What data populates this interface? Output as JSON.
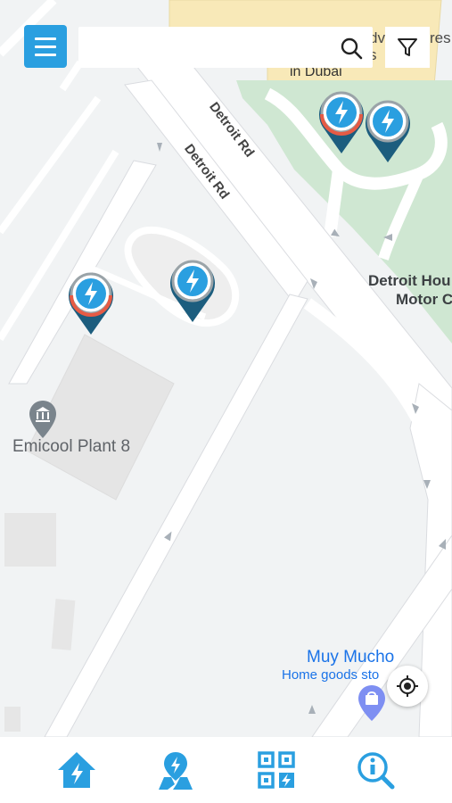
{
  "map": {
    "roads": [
      {
        "label": "Detroit Rd"
      },
      {
        "label": "Detroit Rd"
      }
    ],
    "pois": {
      "top_partial_line1": "dv",
      "top_partial_line2": "s",
      "top_partial_res": "res",
      "top_partial_dubai": "in Dubai",
      "detroit_house_line1": "Detroit Hou",
      "detroit_house_line2": "Motor C",
      "emicool": "Emicool Plant 8",
      "muy_mucho": "Muy Mucho",
      "muy_mucho_sub": "Home goods sto"
    },
    "markers": [
      {
        "id": "marker-1",
        "status": "partially-busy"
      },
      {
        "id": "marker-2",
        "status": "available"
      },
      {
        "id": "marker-3",
        "status": "partially-busy"
      },
      {
        "id": "marker-4",
        "status": "available"
      }
    ]
  },
  "search": {
    "value": "",
    "placeholder": ""
  },
  "colors": {
    "primary": "#2a9fe0",
    "marker_dark": "#1c5d7e",
    "marker_ring": "#e65b45",
    "park": "#cfe7d2"
  },
  "icons": {
    "menu": "menu-icon",
    "search": "search-icon",
    "filter": "filter-icon",
    "locate": "my-location-icon",
    "nav_home": "home-charging-icon",
    "nav_map": "map-charging-icon",
    "nav_scan": "qr-scan-icon",
    "nav_info": "info-search-icon"
  }
}
